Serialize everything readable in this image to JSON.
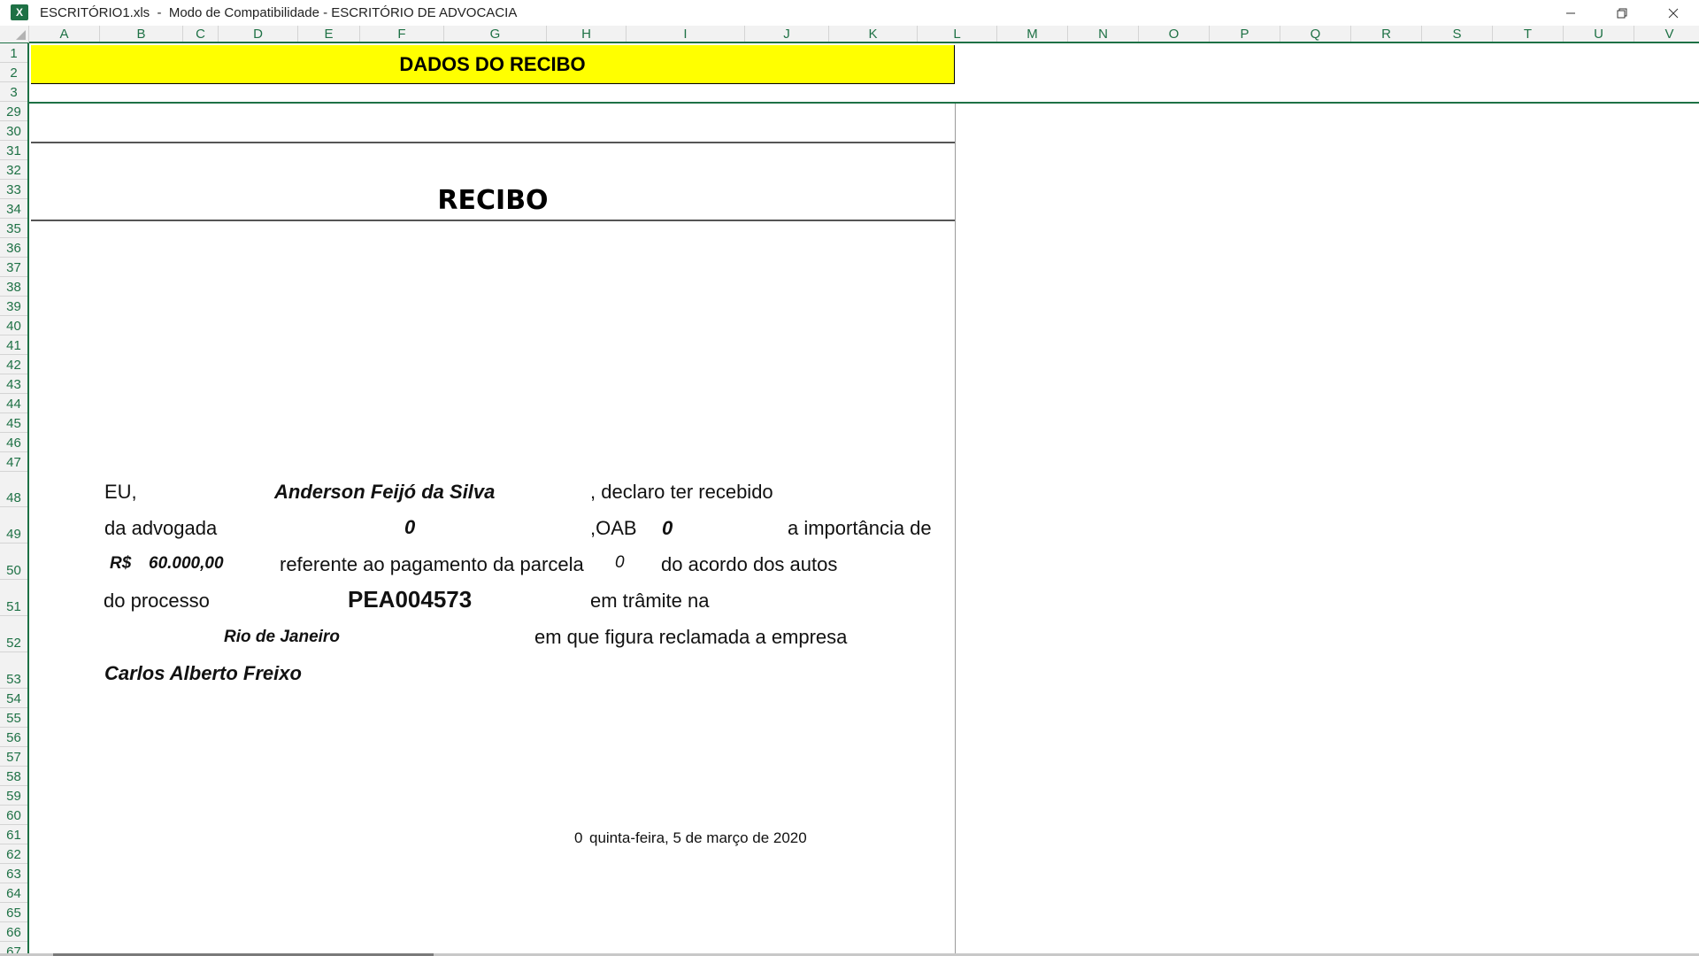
{
  "window": {
    "title": "ESCRITÓRIO1.xls  -  Modo de Compatibilidade - ESCRITÓRIO DE ADVOCACIA",
    "app_icon_letter": "X",
    "app_icon": "excel-icon",
    "accent_color": "#1e7145"
  },
  "grid": {
    "columns": [
      "A",
      "B",
      "C",
      "D",
      "E",
      "F",
      "G",
      "H",
      "I",
      "J",
      "K",
      "L",
      "M",
      "N",
      "O",
      "P",
      "Q",
      "R",
      "S",
      "T",
      "U",
      "V"
    ],
    "rows": [
      "1",
      "2",
      "3",
      "29",
      "30",
      "31",
      "32",
      "33",
      "34",
      "35",
      "36",
      "37",
      "38",
      "39",
      "40",
      "41",
      "42",
      "43",
      "44",
      "45",
      "46",
      "47",
      "48",
      "49",
      "50",
      "51",
      "52",
      "53",
      "54",
      "55",
      "56",
      "57",
      "58",
      "59",
      "60",
      "61",
      "62",
      "63",
      "64",
      "65",
      "66",
      "67"
    ]
  },
  "sheet": {
    "banner_title": "DADOS DO RECIBO",
    "banner_color": "#ffff00",
    "recibo_title": "RECIBO",
    "line48": {
      "eu": "EU,",
      "name": "Anderson Feijó da Silva",
      "declaro": ", declaro ter recebido"
    },
    "line49": {
      "da_advogada": "da  advogada",
      "advogada_value": "0",
      "oab_label": ",OAB",
      "oab_value": "0",
      "importancia": "a importância de"
    },
    "line50": {
      "currency": "R$",
      "amount": "60.000,00",
      "referente": "referente ao pagamento da parcela",
      "parcela": "0",
      "acordo": "do acordo dos autos"
    },
    "line51": {
      "do_processo": "do processo",
      "processo": "PEA004573",
      "tramite": "em trâmite na"
    },
    "line52": {
      "local": "Rio de Janeiro",
      "reclamada": "em que figura reclamada a empresa"
    },
    "line53": {
      "empresa": "Carlos Alberto Freixo"
    },
    "line61": {
      "date_prefix": "0",
      "date": "quinta-feira, 5 de março de 2020"
    }
  }
}
